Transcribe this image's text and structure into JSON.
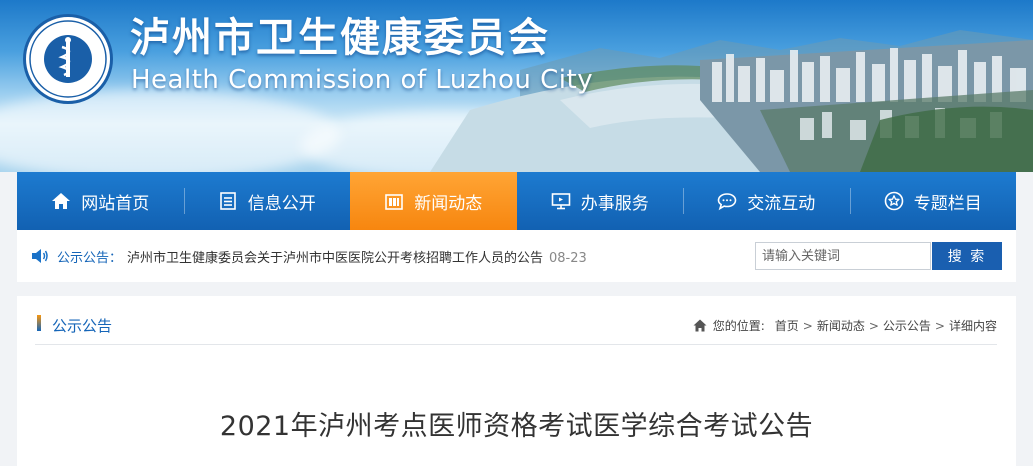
{
  "site": {
    "title_cn": "泸州市卫生健康委员会",
    "title_en": "Health Commission of Luzhou City",
    "emblem_text_cn": "泸州市卫生健康委员会",
    "emblem_text_en": "Health Commission of Luzhou City"
  },
  "nav": {
    "items": [
      {
        "label": "网站首页",
        "icon": "home-icon"
      },
      {
        "label": "信息公开",
        "icon": "document-list-icon"
      },
      {
        "label": "新闻动态",
        "icon": "news-building-icon",
        "active": true
      },
      {
        "label": "办事服务",
        "icon": "monitor-icon"
      },
      {
        "label": "交流互动",
        "icon": "chat-bubble-icon"
      },
      {
        "label": "专题栏目",
        "icon": "star-circle-icon"
      }
    ]
  },
  "notice": {
    "label": "公示公告：",
    "text": "泸州市卫生健康委员会关于泸州市中医医院公开考核招聘工作人员的公告",
    "date": "08-23"
  },
  "search": {
    "placeholder": "请输入关键词",
    "button_label": "搜 索"
  },
  "section": {
    "title": "公示公告"
  },
  "breadcrumb": {
    "label": "您的位置:",
    "items": [
      "首页",
      "新闻动态",
      "公示公告",
      "详细内容"
    ]
  },
  "article": {
    "title": "2021年泸州考点医师资格考试医学综合考试公告"
  },
  "colors": {
    "nav_blue": "#1565b8",
    "nav_active_orange": "#f7860f",
    "search_button": "#1a5fb0",
    "accent_text": "#1565b8"
  }
}
